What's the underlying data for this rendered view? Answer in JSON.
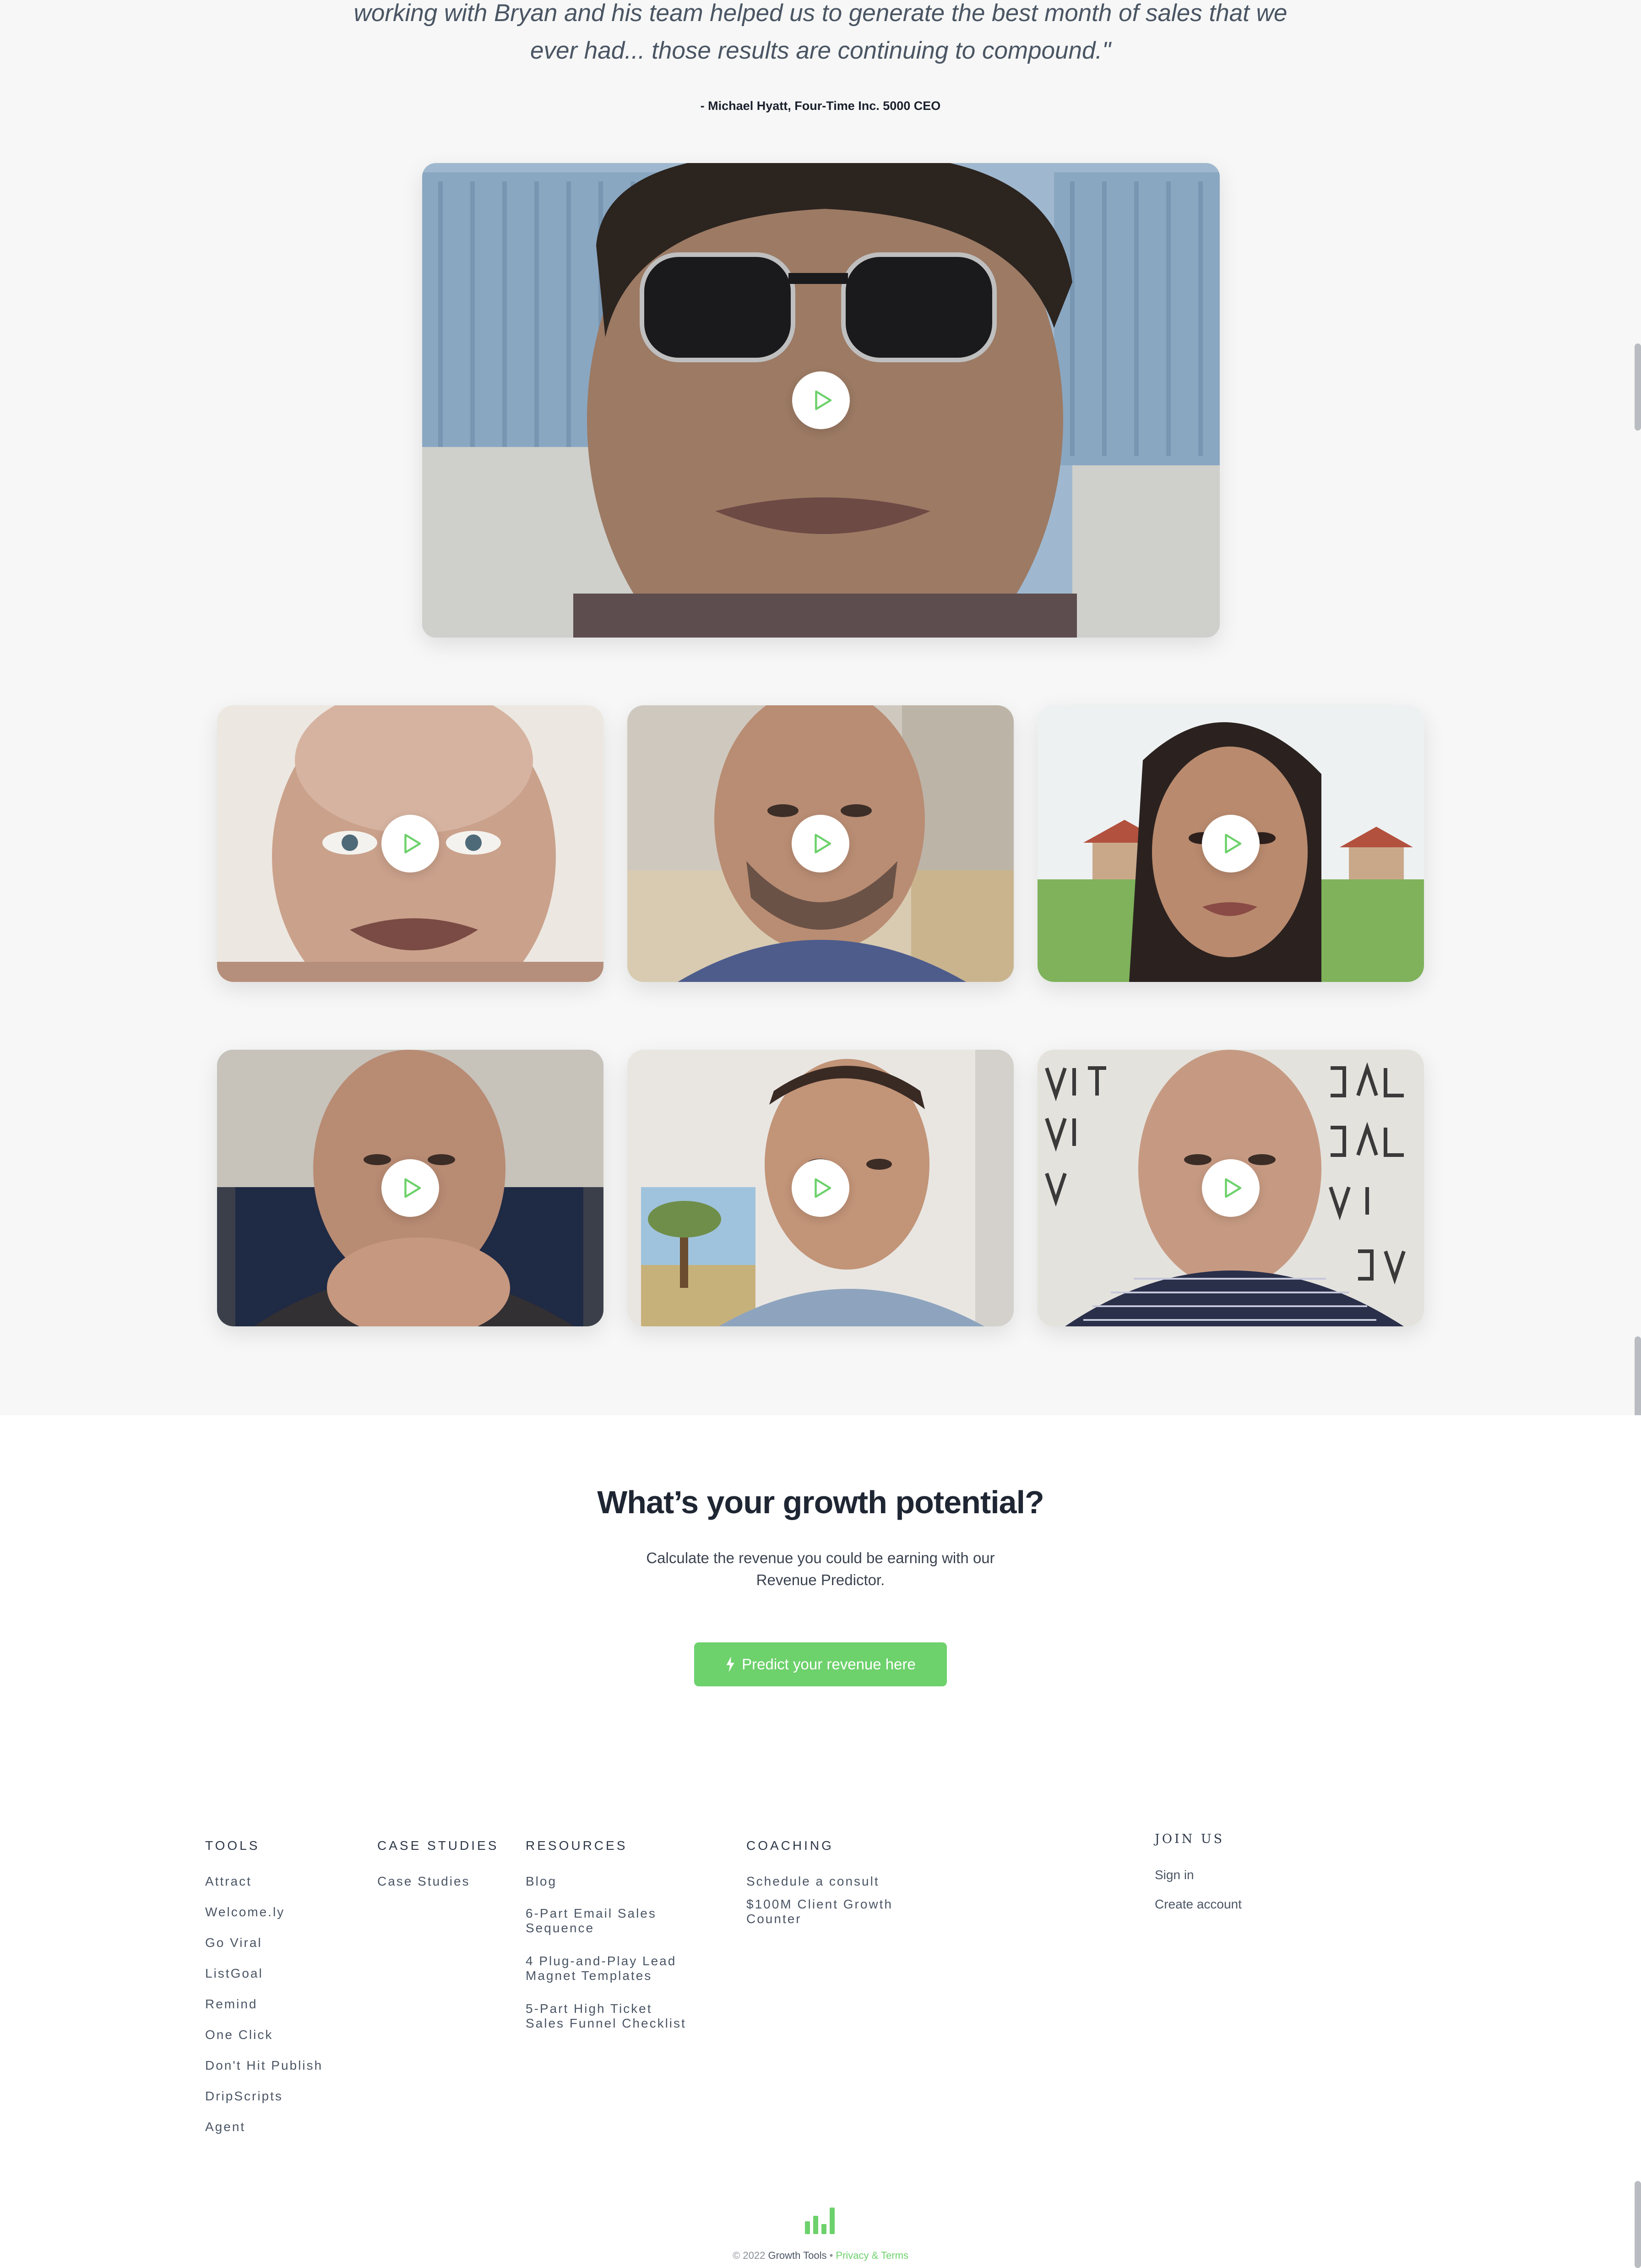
{
  "testimonial": {
    "quote_line1": "working with Bryan and his team helped us to generate the best month of sales that we",
    "quote_line2": "ever had... those results are continuing to compound.\"",
    "author": "- Michael Hyatt, Four-Time Inc. 5000 CEO"
  },
  "videos": {
    "play_icon": "play-icon",
    "accent": "#6dd16c"
  },
  "cta": {
    "heading": "What’s your growth potential?",
    "sub_line1": "Calculate the revenue you could be earning with our",
    "sub_line2": "Revenue Predictor.",
    "button_icon": "lightning-icon",
    "button_label": "Predict your revenue here"
  },
  "footer": {
    "tools": {
      "heading": "TOOLS",
      "links": [
        "Attract",
        "Welcome.ly",
        "Go Viral",
        "ListGoal",
        "Remind",
        "One Click",
        "Don't Hit Publish",
        "DripScripts",
        "Agent"
      ]
    },
    "case_studies": {
      "heading": "CASE STUDIES",
      "links": [
        "Case Studies"
      ]
    },
    "resources": {
      "heading": "RESOURCES",
      "links": [
        "Blog",
        "6-Part Email Sales",
        "Sequence",
        "4 Plug-and-Play Lead",
        "Magnet Templates",
        "5-Part High Ticket",
        "Sales Funnel Checklist"
      ]
    },
    "coaching": {
      "heading": "COACHING",
      "links": [
        "Schedule a consult",
        "$100M Client Growth",
        "Counter"
      ]
    },
    "join": {
      "heading": "JOIN US",
      "links": [
        "Sign in",
        "Create account"
      ]
    },
    "copyright": "© 2022",
    "brand": "Growth Tools",
    "separator": "•",
    "terms": "Privacy & Terms",
    "logo_icon": "bar-chart-logo-icon"
  }
}
